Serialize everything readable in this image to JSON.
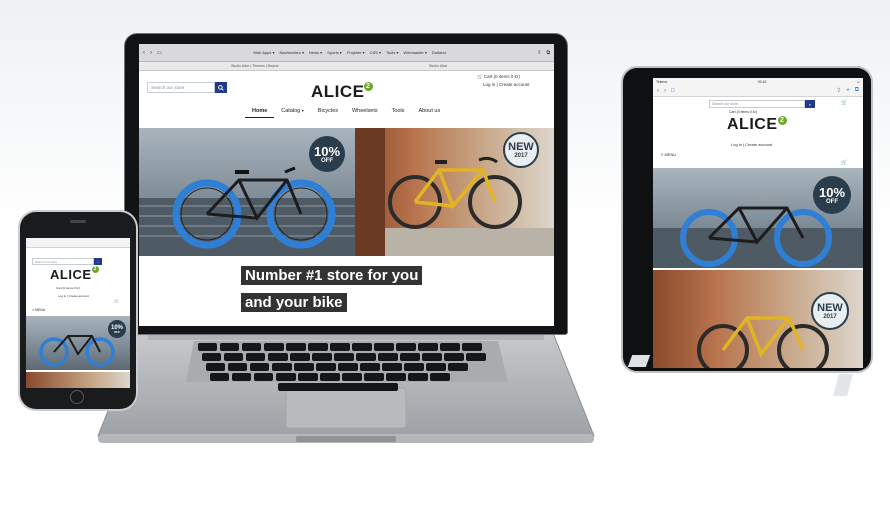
{
  "laptop": {
    "browser_bookmarks": [
      "Web Apps ▾",
      "Nachrichten ▾",
      "News ▾",
      "Sports ▾",
      "Projekte ▾",
      "CSS ▾",
      "Tools ▾",
      "Webmaster ▾",
      "Dotland"
    ],
    "tab_title": "Studio Alice",
    "breadcrumb": "Studio Alice | Themes | Bicycle",
    "search_placeholder": "Search our store",
    "cart_text": "Cart (0 items 0 kr)",
    "account_links": "Log in | Create account",
    "logo": "ALICE",
    "logo_badge": "2",
    "nav": [
      "Home",
      "Catalog",
      "Bicycles",
      "Wheelsets",
      "Tools",
      "About us"
    ],
    "promo_discount": "10%",
    "promo_discount_sub": "OFF",
    "promo_new": "NEW",
    "promo_new_sub": "2017",
    "headline_line1": "Number #1 store for you",
    "headline_line2": "and your bike"
  },
  "tablet": {
    "status_left": "Telenor",
    "status_time": "09:16",
    "search_placeholder": "Search our store",
    "cart_text": "Cart (0 items 0 kr)",
    "logo": "ALICE",
    "logo_badge": "2",
    "account_links": "Log in | Create account",
    "menu_label": "MENU",
    "promo_discount": "10%",
    "promo_discount_sub": "OFF",
    "promo_new": "NEW",
    "promo_new_sub": "2017"
  },
  "phone": {
    "search_placeholder": "Search our store",
    "logo": "ALICE",
    "logo_badge": "2",
    "cart_text": "Cart (0 items 0 kr)",
    "account_links": "Log in | Create account",
    "menu_label": "MENU",
    "promo_discount": "10%",
    "promo_discount_sub": "OFF"
  },
  "colors": {
    "search_button": "#223a8a",
    "logo_badge": "#6aa82c",
    "promo_dark": "#2a3d4c",
    "bike_wheel": "#2f7fd6",
    "bike_frame_yellow": "#e2b423"
  }
}
